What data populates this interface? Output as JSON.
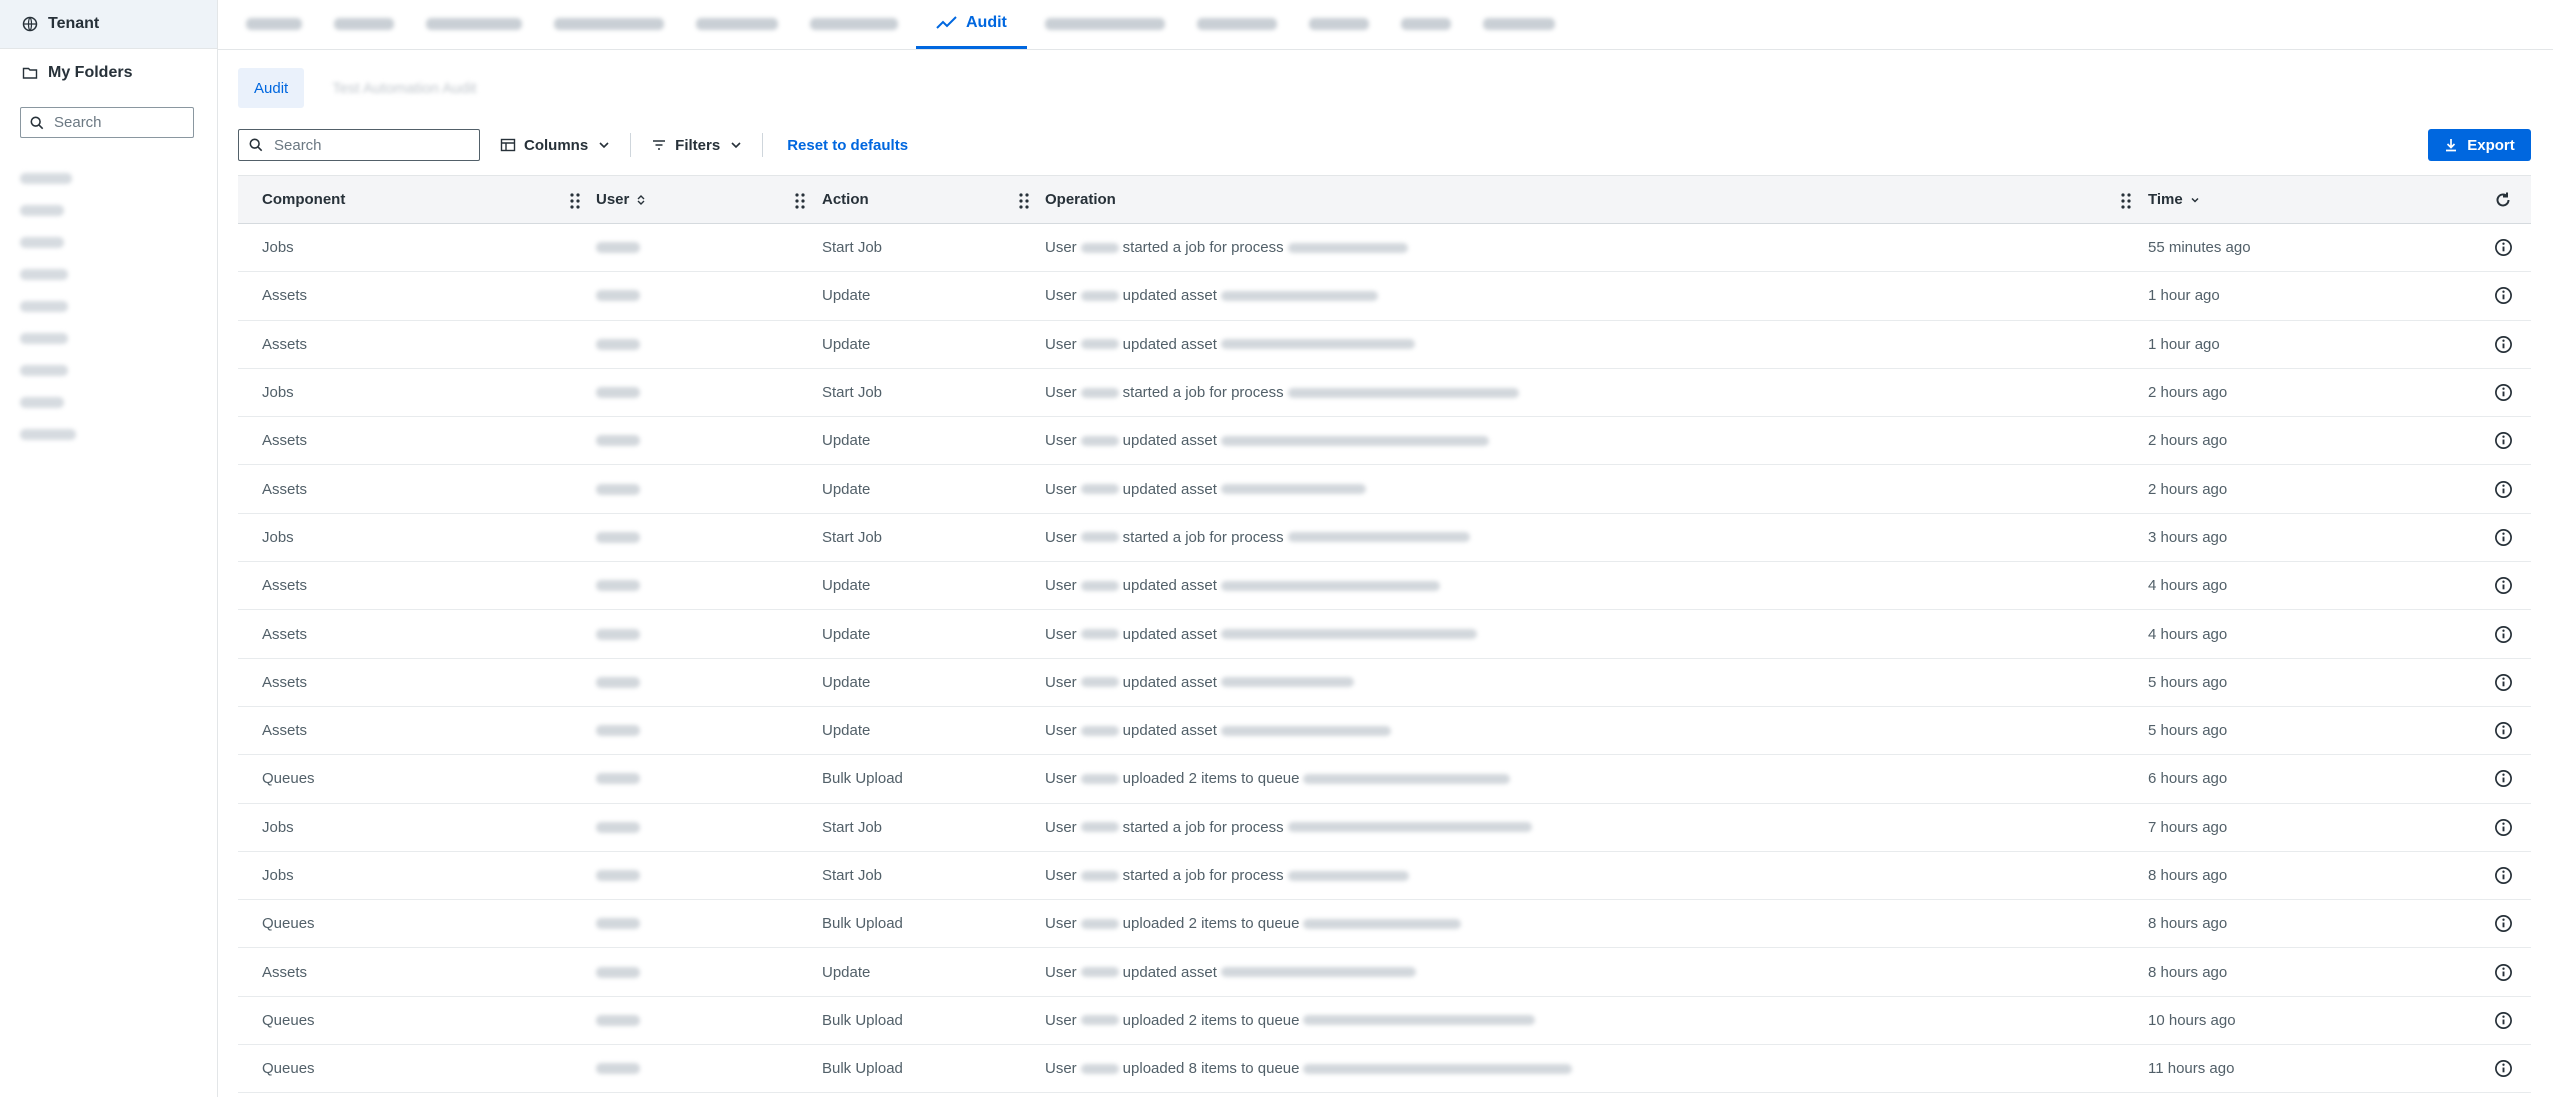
{
  "sidebar": {
    "tenant_label": "Tenant",
    "folders_label": "My Folders",
    "search_placeholder": "Search",
    "folder_items": [
      {
        "redacted_width": 52
      },
      {
        "redacted_width": 44
      },
      {
        "redacted_width": 44
      },
      {
        "redacted_width": 48
      },
      {
        "redacted_width": 48
      },
      {
        "redacted_width": 48
      },
      {
        "redacted_width": 48
      },
      {
        "redacted_width": 44
      },
      {
        "redacted_width": 56
      }
    ]
  },
  "topnav": {
    "tabs": [
      {
        "label": "",
        "redacted": true,
        "w": 56
      },
      {
        "label": "",
        "redacted": true,
        "w": 60
      },
      {
        "label": "",
        "redacted": true,
        "w": 96
      },
      {
        "label": "",
        "redacted": true,
        "w": 110
      },
      {
        "label": "",
        "redacted": true,
        "w": 82
      },
      {
        "label": "",
        "redacted": true,
        "w": 88
      },
      {
        "label": "Audit",
        "active": true
      },
      {
        "label": "",
        "redacted": true,
        "w": 120
      },
      {
        "label": "",
        "redacted": true,
        "w": 80
      },
      {
        "label": "",
        "redacted": true,
        "w": 60
      },
      {
        "label": "",
        "redacted": true,
        "w": 50
      },
      {
        "label": "",
        "redacted": true,
        "w": 72
      }
    ]
  },
  "subtabs": {
    "active": "Audit",
    "other": "Test Automation Audit"
  },
  "toolbar": {
    "search_placeholder": "Search",
    "columns_label": "Columns",
    "filters_label": "Filters",
    "reset_label": "Reset to defaults",
    "export_label": "Export"
  },
  "table": {
    "headers": {
      "component": "Component",
      "user": "User",
      "action": "Action",
      "operation": "Operation",
      "time": "Time"
    },
    "rows": [
      {
        "component": "Jobs",
        "action": "Start Job",
        "op_prefix": "User",
        "op_mid": "started a job for process",
        "time": "55 minutes ago"
      },
      {
        "component": "Assets",
        "action": "Update",
        "op_prefix": "User",
        "op_mid": "updated asset",
        "time": "1 hour ago"
      },
      {
        "component": "Assets",
        "action": "Update",
        "op_prefix": "User",
        "op_mid": "updated asset",
        "time": "1 hour ago"
      },
      {
        "component": "Jobs",
        "action": "Start Job",
        "op_prefix": "User",
        "op_mid": "started a job for process",
        "time": "2 hours ago"
      },
      {
        "component": "Assets",
        "action": "Update",
        "op_prefix": "User",
        "op_mid": "updated asset",
        "time": "2 hours ago"
      },
      {
        "component": "Assets",
        "action": "Update",
        "op_prefix": "User",
        "op_mid": "updated asset",
        "time": "2 hours ago"
      },
      {
        "component": "Jobs",
        "action": "Start Job",
        "op_prefix": "User",
        "op_mid": "started a job for process",
        "time": "3 hours ago"
      },
      {
        "component": "Assets",
        "action": "Update",
        "op_prefix": "User",
        "op_mid": "updated asset",
        "time": "4 hours ago"
      },
      {
        "component": "Assets",
        "action": "Update",
        "op_prefix": "User",
        "op_mid": "updated asset",
        "time": "4 hours ago"
      },
      {
        "component": "Assets",
        "action": "Update",
        "op_prefix": "User",
        "op_mid": "updated asset",
        "time": "5 hours ago"
      },
      {
        "component": "Assets",
        "action": "Update",
        "op_prefix": "User",
        "op_mid": "updated asset",
        "time": "5 hours ago"
      },
      {
        "component": "Queues",
        "action": "Bulk Upload",
        "op_prefix": "User",
        "op_mid": "uploaded 2 items to queue",
        "time": "6 hours ago"
      },
      {
        "component": "Jobs",
        "action": "Start Job",
        "op_prefix": "User",
        "op_mid": "started a job for process",
        "time": "7 hours ago"
      },
      {
        "component": "Jobs",
        "action": "Start Job",
        "op_prefix": "User",
        "op_mid": "started a job for process",
        "time": "8 hours ago"
      },
      {
        "component": "Queues",
        "action": "Bulk Upload",
        "op_prefix": "User",
        "op_mid": "uploaded 2 items to queue",
        "time": "8 hours ago"
      },
      {
        "component": "Assets",
        "action": "Update",
        "op_prefix": "User",
        "op_mid": "updated asset",
        "time": "8 hours ago"
      },
      {
        "component": "Queues",
        "action": "Bulk Upload",
        "op_prefix": "User",
        "op_mid": "uploaded 2 items to queue",
        "time": "10 hours ago"
      },
      {
        "component": "Queues",
        "action": "Bulk Upload",
        "op_prefix": "User",
        "op_mid": "uploaded 8 items to queue",
        "time": "11 hours ago"
      }
    ]
  },
  "colors": {
    "accent": "#0067df",
    "header_bg": "#f4f5f7",
    "tenant_bg": "#eef3f8"
  }
}
